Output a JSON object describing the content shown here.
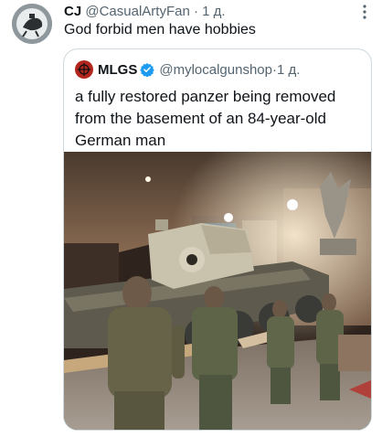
{
  "tweet": {
    "name": "CJ",
    "handle": "@CasualArtyFan",
    "separator": "·",
    "time": "1 д.",
    "text": "God forbid men have hobbies",
    "avatar_icon": "avatar-icon",
    "more_icon": "more-horizontal-icon"
  },
  "quoted_tweet": {
    "name": "MLGS",
    "handle": "@mylocalgunshop",
    "separator": "·",
    "time": "1 д.",
    "text": "a fully restored panzer being removed from the basement of an 84-year-old German man",
    "verified_icon": "verified-badge-icon",
    "verified_color": "#1d9bf0",
    "media_icon": "photo"
  },
  "colors": {
    "text": "#0f1419",
    "secondary": "#536471",
    "border": "#cfd9de",
    "avatar_accent": "#b3261e"
  }
}
